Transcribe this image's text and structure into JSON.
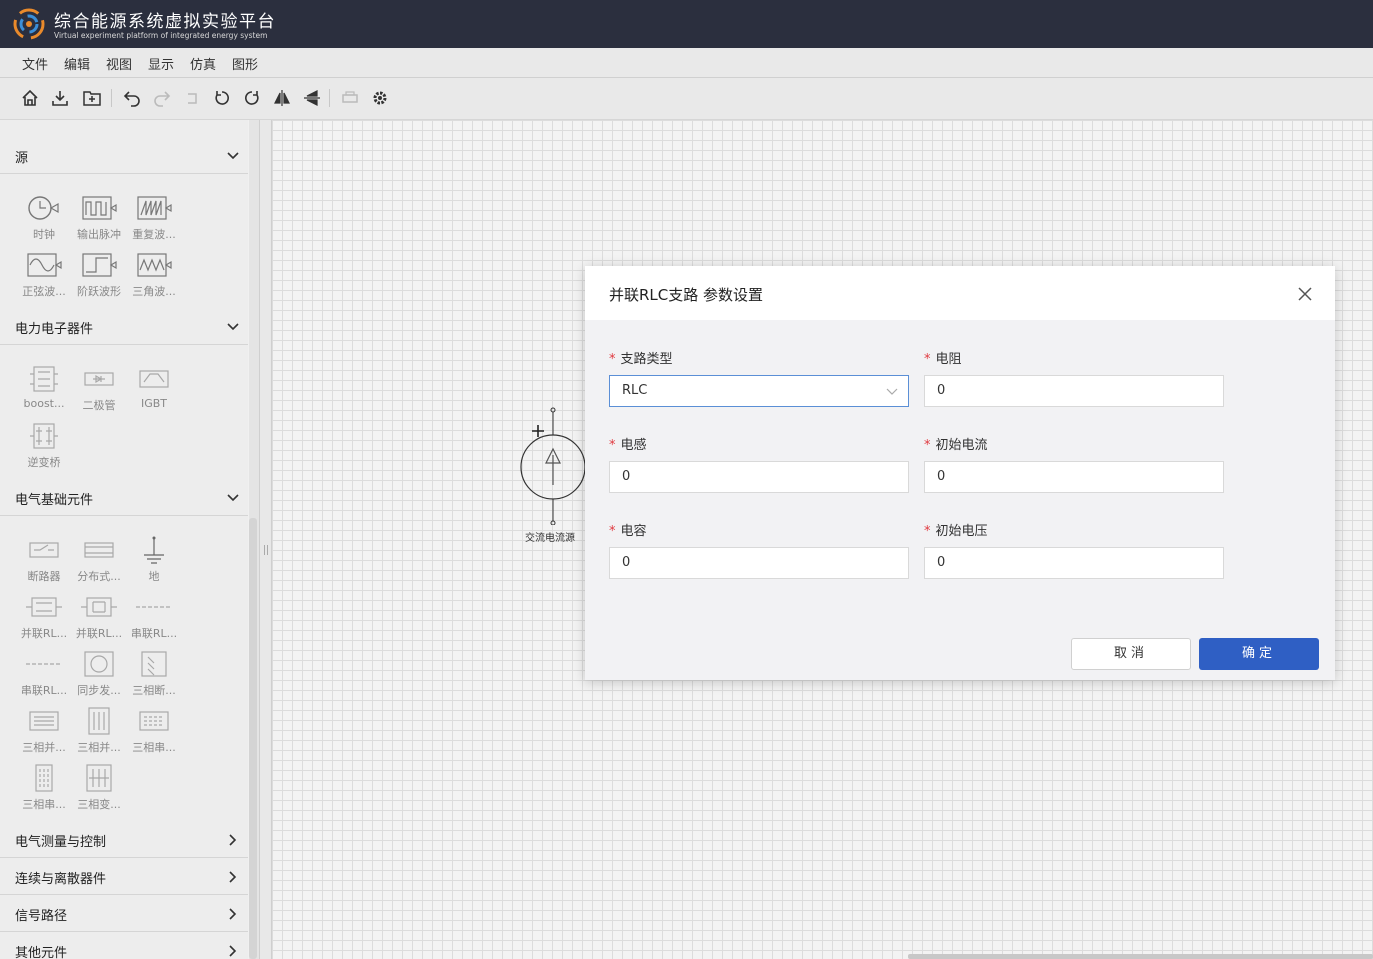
{
  "app": {
    "title_cn": "综合能源系统虚拟实验平台",
    "title_en": "Virtual experiment platform of integrated energy system"
  },
  "menu": [
    "文件",
    "编辑",
    "视图",
    "显示",
    "仿真",
    "图形"
  ],
  "toolbar": {
    "icons": [
      "home-icon",
      "download-icon",
      "folder-add-icon",
      "undo-icon",
      "redo-icon",
      "step-back-icon",
      "rotate-left-icon",
      "rotate-right-icon",
      "flip-horizontal-icon",
      "flip-vertical-icon",
      "print-icon",
      "settings-icon"
    ]
  },
  "sidebar": {
    "sections": [
      {
        "label": "源",
        "expanded": true,
        "items": [
          "时钟",
          "输出脉冲",
          "重复波...",
          "正弦波...",
          "阶跃波形",
          "三角波..."
        ]
      },
      {
        "label": "电力电子器件",
        "expanded": true,
        "items": [
          "boost...",
          "二极管",
          "IGBT",
          "逆变桥"
        ]
      },
      {
        "label": "电气基础元件",
        "expanded": true,
        "items": [
          "断路器",
          "分布式...",
          "地",
          "并联RL...",
          "并联RL...",
          "串联RL...",
          "串联RL...",
          "同步发...",
          "三相断...",
          "三相并...",
          "三相并...",
          "三相串...",
          "三相串...",
          "三相变..."
        ]
      },
      {
        "label": "电气测量与控制",
        "expanded": false
      },
      {
        "label": "连续与离散器件",
        "expanded": false
      },
      {
        "label": "信号路径",
        "expanded": false
      },
      {
        "label": "其他元件",
        "expanded": false
      }
    ]
  },
  "canvas": {
    "component_label": "交流电流源",
    "plus_sign": "+"
  },
  "dialog": {
    "title": "并联RLC支路 参数设置",
    "fields": {
      "branch_type": {
        "label": "支路类型",
        "value": "RLC"
      },
      "resistance": {
        "label": "电阻",
        "value": "0"
      },
      "inductance": {
        "label": "电感",
        "value": "0"
      },
      "initial_current": {
        "label": "初始电流",
        "value": "0"
      },
      "capacitance": {
        "label": "电容",
        "value": "0"
      },
      "initial_voltage": {
        "label": "初始电压",
        "value": "0"
      }
    },
    "required_mark": "*",
    "cancel_label": "取消",
    "ok_label": "确定"
  },
  "colors": {
    "header_bg": "#2b2f3e",
    "primary": "#2f5fc4",
    "required": "#e0383e"
  }
}
